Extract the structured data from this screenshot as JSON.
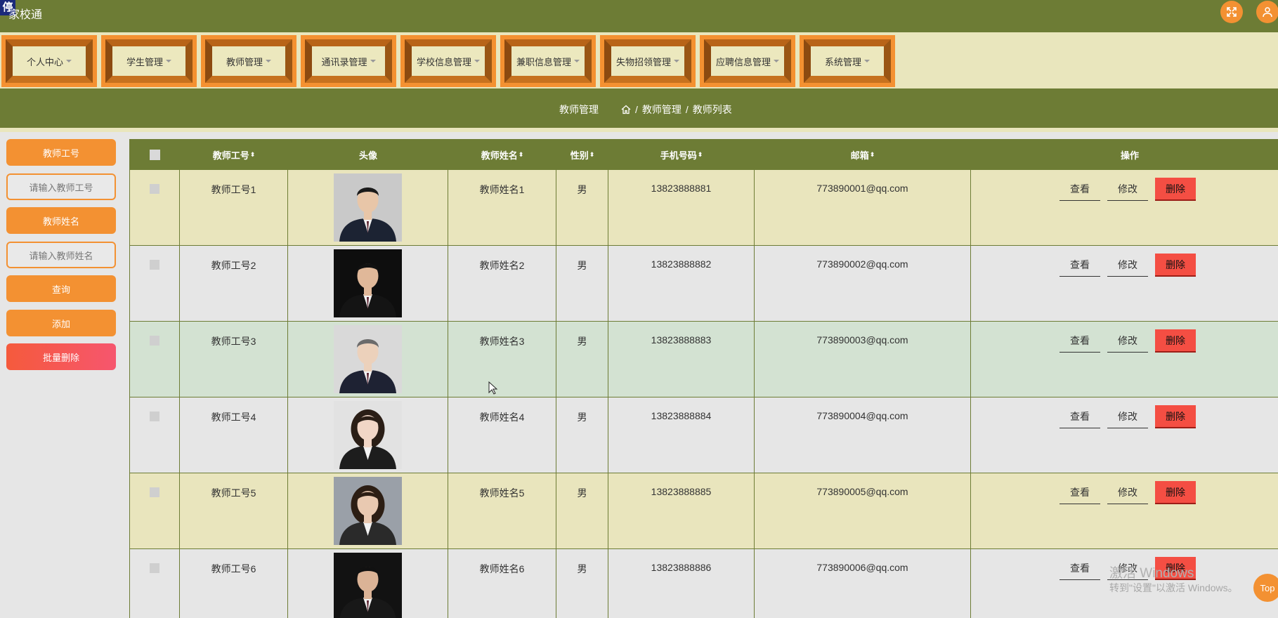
{
  "app": {
    "title": "家校通",
    "logo_char": "停"
  },
  "header": {
    "fullscreen_icon": "expand-icon",
    "user_icon": "user-icon"
  },
  "menu": [
    "个人中心",
    "学生管理",
    "教师管理",
    "通讯录管理",
    "学校信息管理",
    "兼职信息管理",
    "失物招领管理",
    "应聘信息管理",
    "系统管理"
  ],
  "breadcrumb": {
    "section": "教师管理",
    "path1": "教师管理",
    "sep": "/",
    "path2": "教师列表"
  },
  "sidebar": {
    "label_id": "教师工号",
    "placeholder_id": "请输入教师工号",
    "label_name": "教师姓名",
    "placeholder_name": "请输入教师姓名",
    "search": "查询",
    "add": "添加",
    "batch_delete": "批量删除"
  },
  "table": {
    "headers": {
      "id": "教师工号",
      "avatar": "头像",
      "name": "教师姓名",
      "gender": "性别",
      "phone": "手机号码",
      "email": "邮箱",
      "ops": "操作",
      "sort_glyph": "⬍"
    },
    "actions": {
      "view": "查看",
      "edit": "修改",
      "delete": "删除"
    },
    "rows": [
      {
        "id": "教师工号1",
        "name": "教师姓名1",
        "gender": "男",
        "phone": "13823888881",
        "email": "773890001@qq.com"
      },
      {
        "id": "教师工号2",
        "name": "教师姓名2",
        "gender": "男",
        "phone": "13823888882",
        "email": "773890002@qq.com"
      },
      {
        "id": "教师工号3",
        "name": "教师姓名3",
        "gender": "男",
        "phone": "13823888883",
        "email": "773890003@qq.com"
      },
      {
        "id": "教师工号4",
        "name": "教师姓名4",
        "gender": "男",
        "phone": "13823888884",
        "email": "773890004@qq.com"
      },
      {
        "id": "教师工号5",
        "name": "教师姓名5",
        "gender": "男",
        "phone": "13823888885",
        "email": "773890005@qq.com"
      },
      {
        "id": "教师工号6",
        "name": "教师姓名6",
        "gender": "男",
        "phone": "13823888886",
        "email": "773890006@qq.com"
      }
    ]
  },
  "watermark": {
    "line1": "激活 Windows",
    "line2": "转到\"设置\"以激活 Windows。"
  },
  "top_button": "Top",
  "colors": {
    "olive": "#6d7c35",
    "orange": "#f39132",
    "cream": "#e9e6bd",
    "danger": "#f44e43",
    "row_highlight": "#d3e2d2"
  }
}
